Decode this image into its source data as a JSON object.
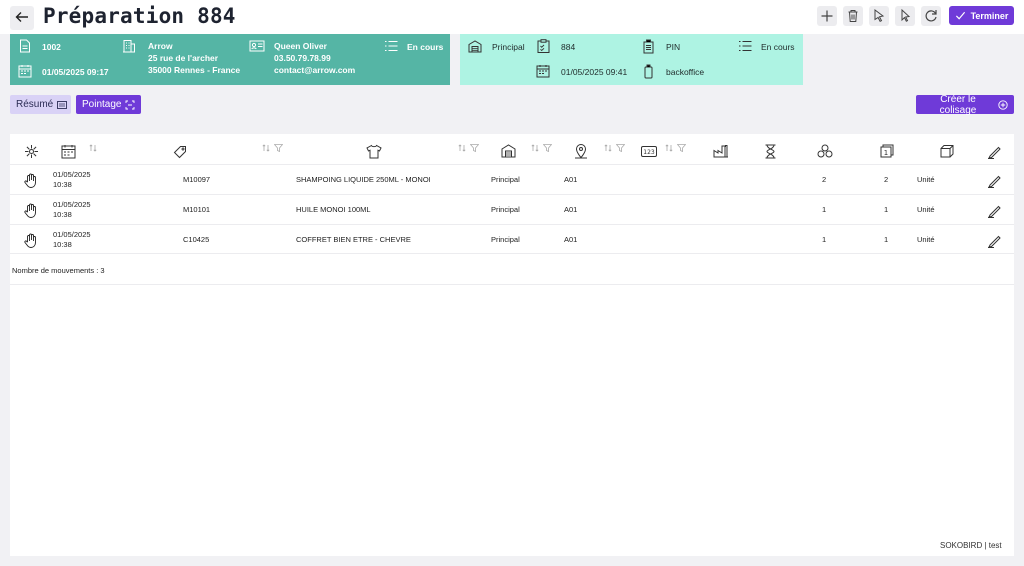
{
  "header": {
    "title": "Préparation 884",
    "finish_label": "Terminer",
    "tools": [
      "plus-icon",
      "trash-icon",
      "cursor-select-icon",
      "cursor-icon",
      "refresh-icon"
    ]
  },
  "card_left": {
    "number": "1002",
    "date": "01/05/2025 09:17",
    "company": "Arrow",
    "address1": "25 rue de l'archer",
    "address2": "35000 Rennes - France",
    "contact_name": "Queen Oliver",
    "phone": "03.50.79.78.99",
    "email": "contact@arrow.com",
    "status": "En cours"
  },
  "card_right": {
    "warehouse": "Principal",
    "prep_number": "884",
    "date": "01/05/2025 09:41",
    "mode": "PIN",
    "status": "En cours",
    "device": "backoffice"
  },
  "actions": {
    "summary_label": "Résumé",
    "pointage_label": "Pointage",
    "create_pack_label": "Créer le colisage"
  },
  "table": {
    "rows": [
      {
        "date": "01/05/2025",
        "time": "10:38",
        "ref": "M10097",
        "product": "SHAMPOING LIQUIDE 250ML - MONOI",
        "warehouse": "Principal",
        "location": "A01",
        "qty": "2",
        "qty2": "2",
        "unit": "Unité"
      },
      {
        "date": "01/05/2025",
        "time": "10:38",
        "ref": "M10101",
        "product": "HUILE MONOI 100ML",
        "warehouse": "Principal",
        "location": "A01",
        "qty": "1",
        "qty2": "1",
        "unit": "Unité"
      },
      {
        "date": "01/05/2025",
        "time": "10:38",
        "ref": "C10425",
        "product": "COFFRET BIEN ETRE - CHEVRE",
        "warehouse": "Principal",
        "location": "A01",
        "qty": "1",
        "qty2": "1",
        "unit": "Unité"
      }
    ],
    "count_label": "Nombre de mouvements : 3"
  },
  "footer": {
    "text": "SOKOBIRD | test"
  },
  "colors": {
    "accent": "#6f3ad8",
    "card_left": "#55b5a5",
    "card_right": "#aef3e3"
  }
}
